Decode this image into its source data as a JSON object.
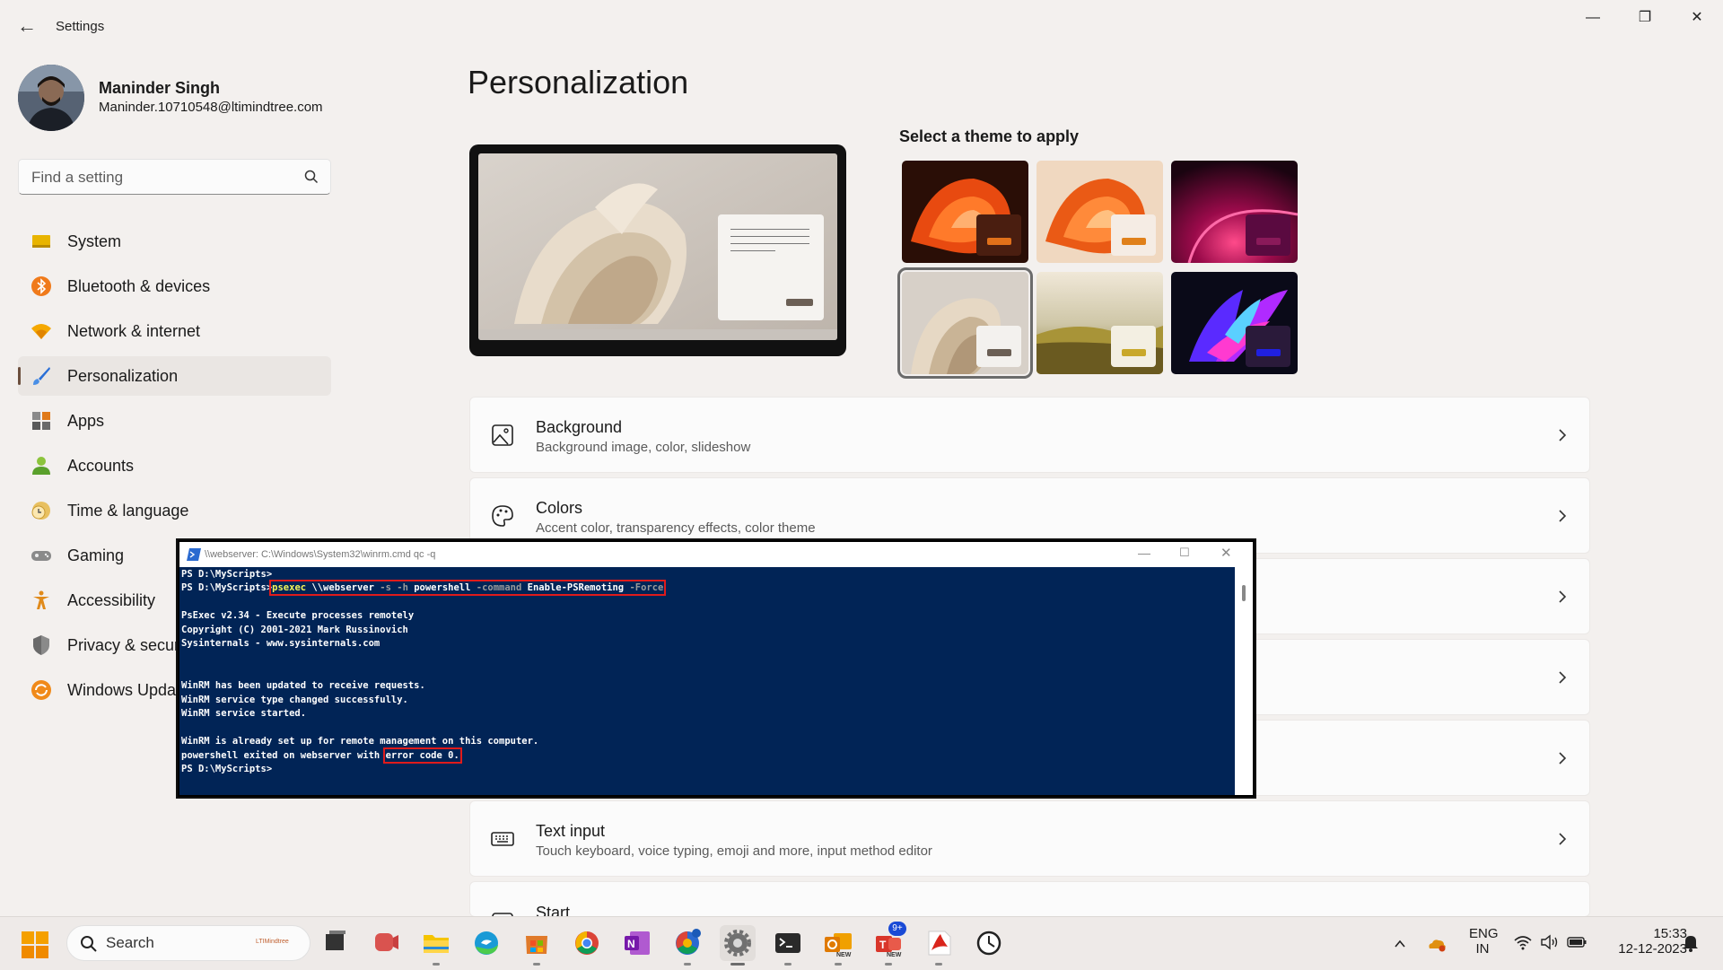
{
  "window": {
    "title": "Settings",
    "back": "←",
    "minimize": "—",
    "maximize": "❐",
    "close": "✕"
  },
  "profile": {
    "name": "Maninder Singh",
    "email": "Maninder.10710548@ltimindtree.com"
  },
  "search": {
    "placeholder": "Find a setting"
  },
  "nav": [
    {
      "label": "System",
      "icon": "system-icon"
    },
    {
      "label": "Bluetooth & devices",
      "icon": "bluetooth-icon"
    },
    {
      "label": "Network & internet",
      "icon": "wifi-icon"
    },
    {
      "label": "Personalization",
      "icon": "brush-icon",
      "active": true
    },
    {
      "label": "Apps",
      "icon": "apps-icon"
    },
    {
      "label": "Accounts",
      "icon": "accounts-icon"
    },
    {
      "label": "Time & language",
      "icon": "clock-icon"
    },
    {
      "label": "Gaming",
      "icon": "gamepad-icon"
    },
    {
      "label": "Accessibility",
      "icon": "accessibility-icon"
    },
    {
      "label": "Privacy & securi",
      "icon": "shield-icon"
    },
    {
      "label": "Windows Updat",
      "icon": "update-icon"
    }
  ],
  "main": {
    "title": "Personalization",
    "themes_label": "Select a theme to apply",
    "cards": [
      {
        "title": "Background",
        "subtitle": "Background image, color, slideshow",
        "icon": "image-icon"
      },
      {
        "title": "Colors",
        "subtitle": "Accent color, transparency effects, color theme",
        "icon": "palette-icon"
      },
      {
        "title": "Text input",
        "subtitle": "Touch keyboard, voice typing, emoji and more, input method editor",
        "icon": "keyboard-icon"
      },
      {
        "title": "Start",
        "subtitle": "",
        "icon": "start-icon"
      }
    ]
  },
  "terminal": {
    "title": "\\\\webserver: C:\\Windows\\System32\\winrm.cmd qc -q",
    "prompt1": "PS D:\\MyScripts>",
    "prompt2": "PS D:\\MyScripts>",
    "cmd_exe": "psexec",
    "cmd_target": " \\\\webserver ",
    "cmd_flags": "-s -h",
    "cmd_ps": " powershell ",
    "cmd_param": "-command",
    "cmd_value": " Enable-PSRemoting ",
    "cmd_force": "-Force",
    "line_psexec": "PsExec v2.34 - Execute processes remotely",
    "line_copy": "Copyright (C) 2001-2021 Mark Russinovich",
    "line_sys": "Sysinternals - www.sysinternals.com",
    "line_w1": "WinRM has been updated to receive requests.",
    "line_w2": "WinRM service type changed successfully.",
    "line_w3": "WinRM service started.",
    "line_w4": "WinRM is already set up for remote management on this computer.",
    "line_exit": "powershell exited on webserver with",
    "line_code": "error code 0.",
    "prompt3": "PS D:\\MyScripts>"
  },
  "taskbar": {
    "search": "Search",
    "search_badge": "LTIMindtree",
    "apps": [
      "task-view-icon",
      "teams-meet-icon",
      "file-explorer-icon",
      "edge-icon",
      "store-icon",
      "chrome-icon",
      "onenote-icon",
      "chrome-dev-icon",
      "settings-icon",
      "terminal-icon",
      "outlook-icon",
      "teams-icon",
      "acrobat-icon",
      "clock-app-icon"
    ],
    "teams_badge": "9+",
    "new_badge": "NEW",
    "tray": {
      "lang1": "ENG",
      "lang2": "IN",
      "time": "15:33",
      "date": "12-12-2023"
    }
  },
  "colors": {
    "terminal_bg": "#012456",
    "highlight": "#e01b1b",
    "accent": "#6c4f3d"
  }
}
